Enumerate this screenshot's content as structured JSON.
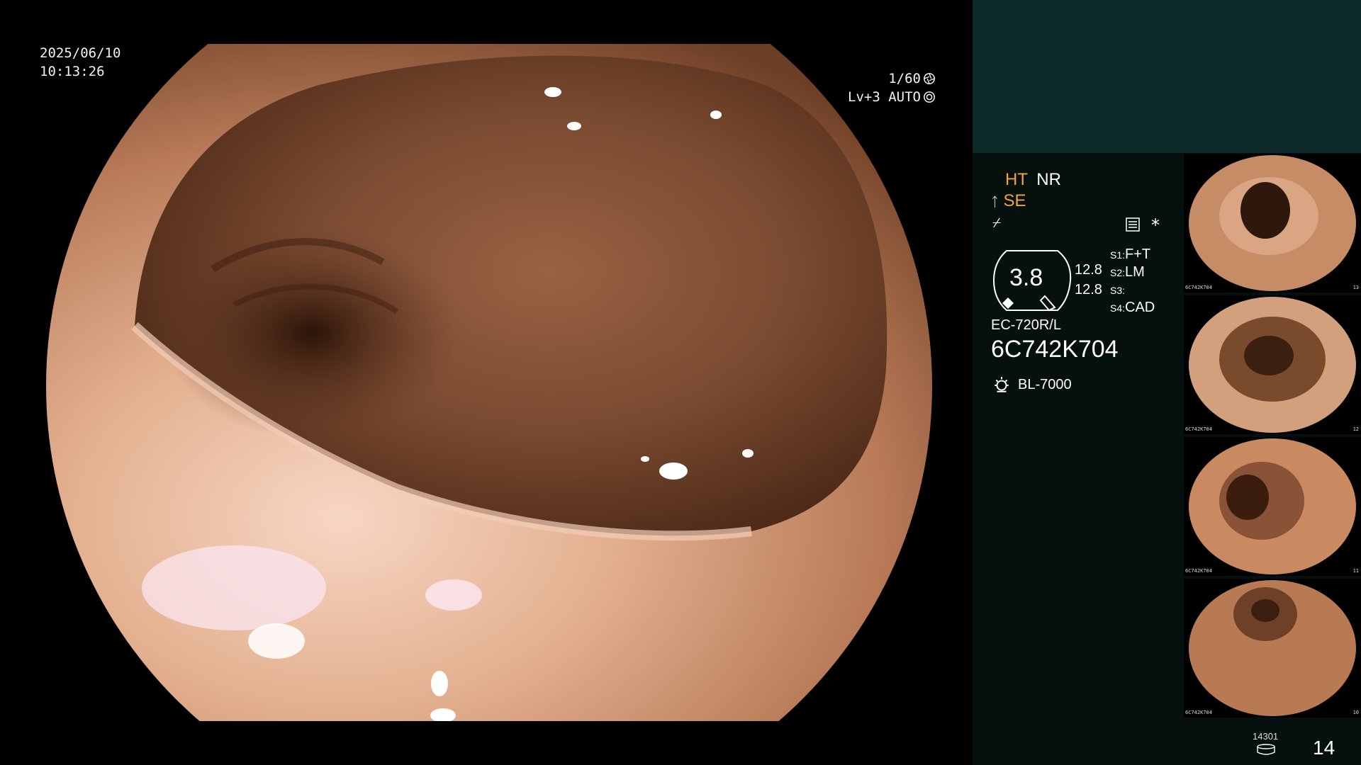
{
  "osd": {
    "date": "2025/06/10",
    "time": "10:13:26",
    "shutter": "1/60",
    "iris": "Lv+3 AUTO"
  },
  "panel": {
    "ht": "HT",
    "nr": "NR",
    "se": "SE",
    "zoom": "3.8",
    "value1": "12.8",
    "value2": "12.8",
    "s1_label": "S1:",
    "s1_value": "F+T",
    "s2_label": "S2:",
    "s2_value": "LM",
    "s3_label": "S3:",
    "s3_value": "",
    "s4_label": "S4:",
    "s4_value": "CAD",
    "scope_model": "EC-720R/L",
    "serial": "6C742K704",
    "light_source": "BL-7000",
    "store_count": "14301",
    "image_number": "14"
  },
  "thumbnails": [
    {
      "label": "6C742K704",
      "num": "13"
    },
    {
      "label": "6C742K704",
      "num": "12"
    },
    {
      "label": "6C742K704",
      "num": "11"
    },
    {
      "label": "6C742K704",
      "num": "10"
    }
  ],
  "colors": {
    "accent_orange": "#f0a43a",
    "panel_bg": "#06100f",
    "panel_top": "#0d2a28",
    "tissue": "#8a5638"
  },
  "icons": [
    "shutter-icon",
    "iris-icon",
    "settings-icon",
    "asterisk-icon",
    "light-source-icon",
    "storage-icon"
  ]
}
